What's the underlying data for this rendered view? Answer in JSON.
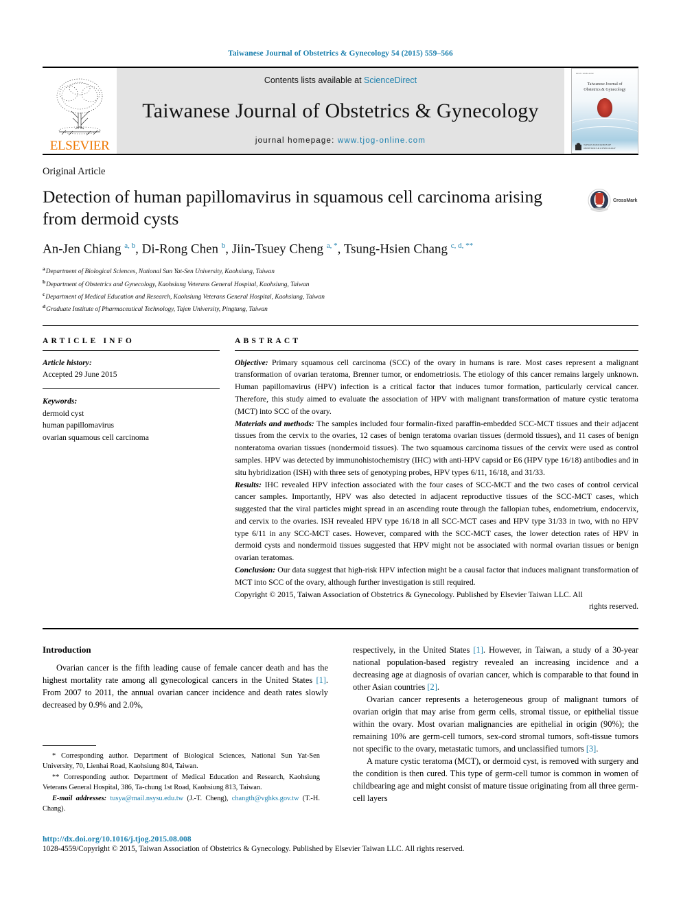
{
  "running_head": "Taiwanese Journal of Obstetrics & Gynecology 54 (2015) 559–566",
  "masthead": {
    "contents_prefix": "Contents lists available at ",
    "sciencedirect": "ScienceDirect",
    "journal_title": "Taiwanese Journal of Obstetrics & Gynecology",
    "homepage_prefix": "journal homepage: ",
    "homepage_url": "www.tjog-online.com",
    "publisher_name": "ELSEVIER",
    "cover": {
      "top_label": "ISSN 1028-4559",
      "journal_name_line1": "Taiwanese Journal of",
      "journal_name_line2": "Obstetrics & Gynecology",
      "footer_line1": "TAIWAN ASSOCIATION OF",
      "footer_line2": "OBSTETRICS & GYNECOLOGY"
    }
  },
  "article": {
    "type": "Original Article",
    "title": "Detection of human papillomavirus in squamous cell carcinoma arising from dermoid cysts",
    "crossmark_label": "CrossMark",
    "authors_html": "An-Jen Chiang <sup>a, b</sup>, Di-Rong Chen <sup>b</sup>, Jiin-Tsuey Cheng <sup>a, <span class=\"star\">*</span></sup>, Tsung-Hsien Chang <sup>c, d, <span class=\"star\">**</span></sup>",
    "affiliations": [
      {
        "mark": "a",
        "text": "Department of Biological Sciences, National Sun Yat-Sen University, Kaohsiung, Taiwan"
      },
      {
        "mark": "b",
        "text": "Department of Obstetrics and Gynecology, Kaohsiung Veterans General Hospital, Kaohsiung, Taiwan"
      },
      {
        "mark": "c",
        "text": "Department of Medical Education and Research, Kaohsiung Veterans General Hospital, Kaohsiung, Taiwan"
      },
      {
        "mark": "d",
        "text": "Graduate Institute of Pharmaceutical Technology, Tajen University, Pingtung, Taiwan"
      }
    ]
  },
  "article_info": {
    "heading": "ARTICLE INFO",
    "history_label": "Article history:",
    "history_value": "Accepted 29 June 2015",
    "keywords_label": "Keywords:",
    "keywords": [
      "dermoid cyst",
      "human papillomavirus",
      "ovarian squamous cell carcinoma"
    ]
  },
  "abstract": {
    "heading": "ABSTRACT",
    "sections": [
      {
        "label": "Objective:",
        "text": "Primary squamous cell carcinoma (SCC) of the ovary in humans is rare. Most cases represent a malignant transformation of ovarian teratoma, Brenner tumor, or endometriosis. The etiology of this cancer remains largely unknown. Human papillomavirus (HPV) infection is a critical factor that induces tumor formation, particularly cervical cancer. Therefore, this study aimed to evaluate the association of HPV with malignant transformation of mature cystic teratoma (MCT) into SCC of the ovary."
      },
      {
        "label": "Materials and methods:",
        "text": "The samples included four formalin-fixed paraffin-embedded SCC-MCT tissues and their adjacent tissues from the cervix to the ovaries, 12 cases of benign teratoma ovarian tissues (dermoid tissues), and 11 cases of benign nonteratoma ovarian tissues (nondermoid tissues). The two squamous carcinoma tissues of the cervix were used as control samples. HPV was detected by immunohistochemistry (IHC) with anti-HPV capsid or E6 (HPV type 16/18) antibodies and in situ hybridization (ISH) with three sets of genotyping probes, HPV types 6/11, 16/18, and 31/33."
      },
      {
        "label": "Results:",
        "text": "IHC revealed HPV infection associated with the four cases of SCC-MCT and the two cases of control cervical cancer samples. Importantly, HPV was also detected in adjacent reproductive tissues of the SCC-MCT cases, which suggested that the viral particles might spread in an ascending route through the fallopian tubes, endometrium, endocervix, and cervix to the ovaries. ISH revealed HPV type 16/18 in all SCC-MCT cases and HPV type 31/33 in two, with no HPV type 6/11 in any SCC-MCT cases. However, compared with the SCC-MCT cases, the lower detection rates of HPV in dermoid cysts and nondermoid tissues suggested that HPV might not be associated with normal ovarian tissues or benign ovarian teratomas."
      },
      {
        "label": "Conclusion:",
        "text": "Our data suggest that high-risk HPV infection might be a causal factor that induces malignant transformation of MCT into SCC of the ovary, although further investigation is still required."
      }
    ],
    "copyright": "Copyright © 2015, Taiwan Association of Obstetrics & Gynecology. Published by Elsevier Taiwan LLC. All",
    "copyright_tail": "rights reserved."
  },
  "body": {
    "intro_heading": "Introduction",
    "left_paragraphs": [
      "Ovarian cancer is the fifth leading cause of female cancer death and has the highest mortality rate among all gynecological cancers in the United States [1]. From 2007 to 2011, the annual ovarian cancer incidence and death rates slowly decreased by 0.9% and 2.0%,"
    ],
    "right_paragraphs": [
      "respectively, in the United States [1]. However, in Taiwan, a study of a 30-year national population-based registry revealed an increasing incidence and a decreasing age at diagnosis of ovarian cancer, which is comparable to that found in other Asian countries [2].",
      "Ovarian cancer represents a heterogeneous group of malignant tumors of ovarian origin that may arise from germ cells, stromal tissue, or epithelial tissue within the ovary. Most ovarian malignancies are epithelial in origin (90%); the remaining 10% are germ-cell tumors, sex-cord stromal tumors, soft-tissue tumors not specific to the ovary, metastatic tumors, and unclassified tumors [3].",
      "A mature cystic teratoma (MCT), or dermoid cyst, is removed with surgery and the condition is then cured. This type of germ-cell tumor is common in women of childbearing age and might consist of mature tissue originating from all three germ-cell layers"
    ]
  },
  "footnotes": {
    "corr1": "* Corresponding author. Department of Biological Sciences, National Sun Yat-Sen University, 70, Lienhai Road, Kaohsiung 804, Taiwan.",
    "corr2": "** Corresponding author. Department of Medical Education and Research, Kaohsiung Veterans General Hospital, 386, Ta-chung 1st Road, Kaohsiung 813, Taiwan.",
    "email_label": "E-mail addresses:",
    "email1": "tusya@mail.nsysu.edu.tw",
    "email1_owner": "(J.-T. Cheng),",
    "email2": "changth@vghks.gov.tw",
    "email2_owner": "(T.-H. Chang)."
  },
  "footer": {
    "doi": "http://dx.doi.org/10.1016/j.tjog.2015.08.008",
    "issn_line": "1028-4559/Copyright © 2015, Taiwan Association of Obstetrics & Gynecology. Published by Elsevier Taiwan LLC. All rights reserved."
  },
  "colors": {
    "link": "#1a7fad",
    "elsevier_orange": "#ee7600",
    "masthead_gray": "#e3e3e3"
  }
}
